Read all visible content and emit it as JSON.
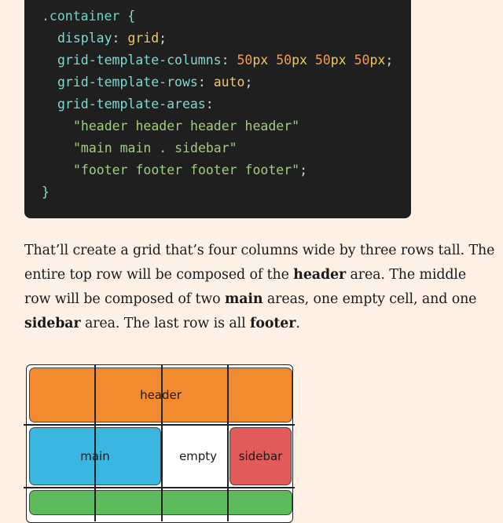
{
  "code": {
    "selector": ".container",
    "open_brace": " {",
    "close_brace": "}",
    "display_prop": "display",
    "display_val": "grid",
    "cols_prop": "grid-template-columns",
    "col_values": [
      "50",
      "50",
      "50",
      "50"
    ],
    "col_unit": "px",
    "rows_prop": "grid-template-rows",
    "rows_val": "auto",
    "areas_prop": "grid-template-areas",
    "area_row1": "\"header header header header\"",
    "area_row2": "\"main main . sidebar\"",
    "area_row3": "\"footer footer footer footer\"",
    "colors": {
      "background": "#1f1f1f",
      "selector": "#6fd2c9",
      "keyword": "#f1c75a",
      "number": "#f19a5b",
      "string": "#9ecf7a"
    }
  },
  "paragraph": {
    "t1": "That’ll create a grid that’s four columns wide by three rows tall. The entire top row will be composed of the ",
    "b1": "header",
    "t2": " area. The middle row will be composed of two ",
    "b2": "main",
    "t3": " areas, one empty cell, and one ",
    "b3": "sidebar",
    "t4": " area. The last row is all ",
    "b4": "footer",
    "t5": "."
  },
  "diagram": {
    "header": "header",
    "main": "main",
    "empty": "empty",
    "sidebar": "sidebar",
    "colors": {
      "header": "#f28a30",
      "main": "#3ab6e0",
      "sidebar": "#e25b5b",
      "footer": "#5cbb5c"
    }
  }
}
